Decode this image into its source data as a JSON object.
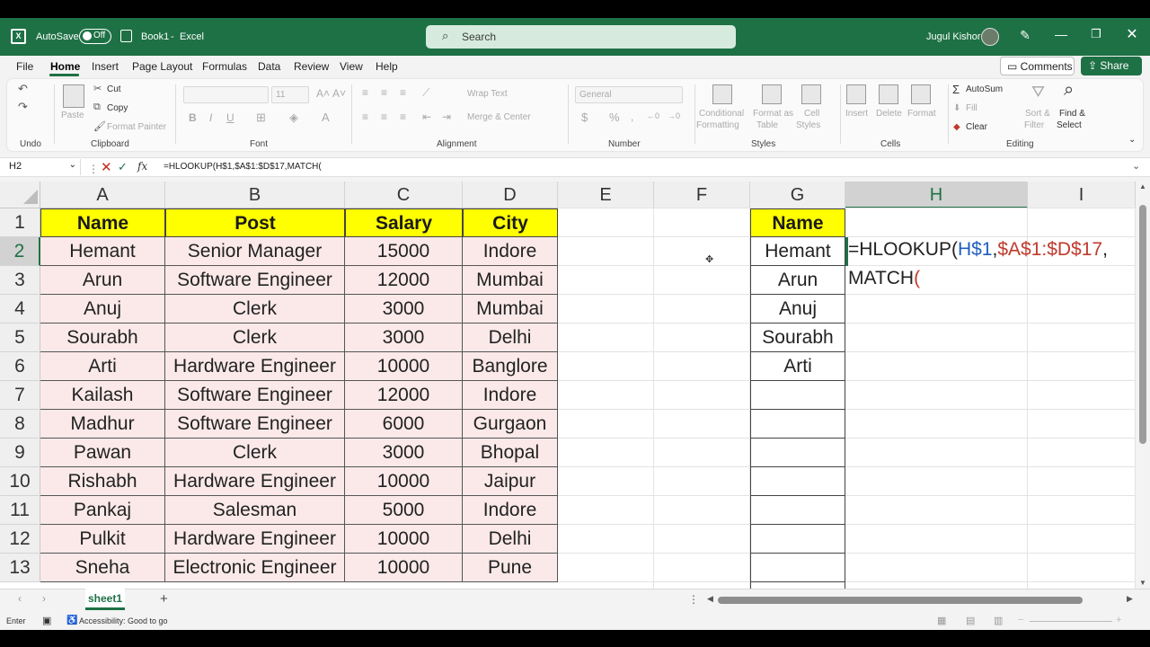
{
  "titlebar": {
    "autosave_label": "AutoSave",
    "autosave_state": "Off",
    "doc_title": "Book1",
    "separator": "-",
    "app_name": "Excel",
    "search_placeholder": "Search",
    "user_name": "Jugul Kishor"
  },
  "menu": {
    "items": [
      "File",
      "Home",
      "Insert",
      "Page Layout",
      "Formulas",
      "Data",
      "Review",
      "View",
      "Help"
    ],
    "active": "Home",
    "comments_label": "Comments",
    "share_label": "Share"
  },
  "ribbon": {
    "undo_label": "Undo",
    "paste_label": "Paste",
    "cut_label": "Cut",
    "copy_label": "Copy",
    "format_painter_label": "Format Painter",
    "clipboard_label": "Clipboard",
    "font_size": "11",
    "bold": "B",
    "italic": "I",
    "underline": "U",
    "font_label": "Font",
    "wrap_text_label": "Wrap Text",
    "merge_center_label": "Merge & Center",
    "alignment_label": "Alignment",
    "number_format": "General",
    "currency_symbol": "$",
    "percent_symbol": "%",
    "number_label": "Number",
    "conditional_formatting_label": "Conditional",
    "conditional_formatting_label2": "Formatting",
    "format_as_table_label": "Format as",
    "format_as_table_label2": "Table",
    "cell_styles_label": "Cell",
    "cell_styles_label2": "Styles",
    "styles_label": "Styles",
    "insert_label": "Insert",
    "delete_label": "Delete",
    "format_label": "Format",
    "cells_label": "Cells",
    "autosum_label": "AutoSum",
    "fill_label": "Fill",
    "clear_label": "Clear",
    "sort_filter_label": "Sort &",
    "sort_filter_label2": "Filter",
    "find_select_label": "Find &",
    "find_select_label2": "Select",
    "editing_label": "Editing"
  },
  "formula_bar": {
    "name_box": "H2",
    "fx": "fx",
    "content": "=HLOOKUP(H$1,$A$1:$D$17,MATCH("
  },
  "columns": [
    "A",
    "B",
    "C",
    "D",
    "E",
    "F",
    "G",
    "H",
    "I"
  ],
  "selected_column": "H",
  "rows": [
    "1",
    "2",
    "3",
    "4",
    "5",
    "6",
    "7",
    "8",
    "9",
    "10",
    "11",
    "12",
    "13"
  ],
  "selected_row": "2",
  "table": {
    "headers": [
      "Name",
      "Post",
      "Salary",
      "City"
    ],
    "rows": [
      [
        "Hemant",
        "Senior Manager",
        "15000",
        "Indore"
      ],
      [
        "Arun",
        "Software Engineer",
        "12000",
        "Mumbai"
      ],
      [
        "Anuj",
        "Clerk",
        "3000",
        "Mumbai"
      ],
      [
        "Sourabh",
        "Clerk",
        "3000",
        "Delhi"
      ],
      [
        "Arti",
        "Hardware Engineer",
        "10000",
        "Banglore"
      ],
      [
        "Kailash",
        "Software Engineer",
        "12000",
        "Indore"
      ],
      [
        "Madhur",
        "Software Engineer",
        "6000",
        "Gurgaon"
      ],
      [
        "Pawan",
        "Clerk",
        "3000",
        "Bhopal"
      ],
      [
        "Rishabh",
        "Hardware Engineer",
        "10000",
        "Jaipur"
      ],
      [
        "Pankaj",
        "Salesman",
        "5000",
        "Indore"
      ],
      [
        "Pulkit",
        "Hardware Engineer",
        "10000",
        "Delhi"
      ],
      [
        "Sneha",
        "Electronic Engineer",
        "10000",
        "Pune"
      ]
    ]
  },
  "lookup": {
    "header": "Name",
    "names": [
      "Hemant",
      "Arun",
      "Anuj",
      "Sourabh",
      "Arti"
    ]
  },
  "editing_cell": {
    "p1": "=HLOOKUP(",
    "p2": "H$1",
    "p3": ",",
    "p4": "$A$1:$D$17",
    "p5": ",",
    "line2a": "MATCH",
    "line2b": "("
  },
  "sheet_tabs": [
    "sheet1"
  ],
  "status": {
    "mode": "Enter",
    "accessibility": "Accessibility: Good to go"
  },
  "colors": {
    "excel_green": "#1e7145",
    "header_fill": "#ffff00",
    "data_fill": "#fbe9e9",
    "ref_blue": "#1f5fbf",
    "ref_red": "#c0392b"
  },
  "icons": [
    "excel-logo-icon",
    "save-icon",
    "search-icon",
    "pen-icon",
    "minimize-icon",
    "restore-icon",
    "close-icon",
    "undo-icon",
    "redo-icon",
    "cut-icon",
    "copy-icon",
    "format-painter-icon",
    "fx-icon",
    "cancel-icon",
    "enter-icon",
    "add-sheet-icon"
  ]
}
